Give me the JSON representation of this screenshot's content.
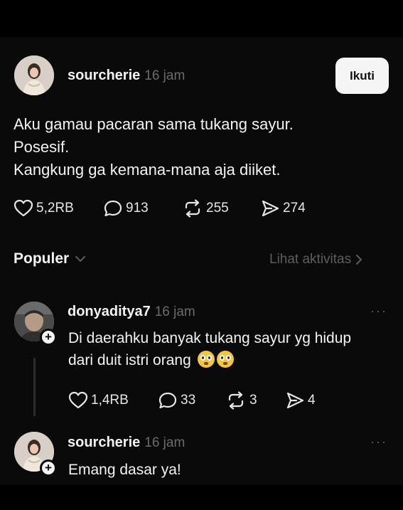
{
  "post": {
    "username": "sourcherie",
    "time": "16 jam",
    "follow_label": "Ikuti",
    "lines": [
      "Aku gamau pacaran sama tukang sayur.",
      "Posesif.",
      "Kangkung ga kemana-mana aja diiket."
    ],
    "actions": {
      "likes": "5,2RB",
      "replies": "913",
      "reposts": "255",
      "shares": "274"
    }
  },
  "section": {
    "title": "Populer",
    "link": "Lihat aktivitas"
  },
  "replies": [
    {
      "username": "donyaditya7",
      "time": "16 jam",
      "lines": [
        "Di daerahku banyak tukang sayur yg hidup",
        "dari duit istri orang"
      ],
      "emoji": "flushed-face-emoji",
      "actions": {
        "likes": "1,4RB",
        "replies": "33",
        "reposts": "3",
        "shares": "4"
      }
    },
    {
      "username": "sourcherie",
      "time": "16 jam",
      "lines": [
        "Emang dasar ya!"
      ]
    }
  ],
  "icons": [
    "heart-icon",
    "comment-icon",
    "repost-icon",
    "share-icon",
    "chevron-down-icon",
    "chevron-right-icon",
    "more-icon",
    "plus-icon"
  ]
}
